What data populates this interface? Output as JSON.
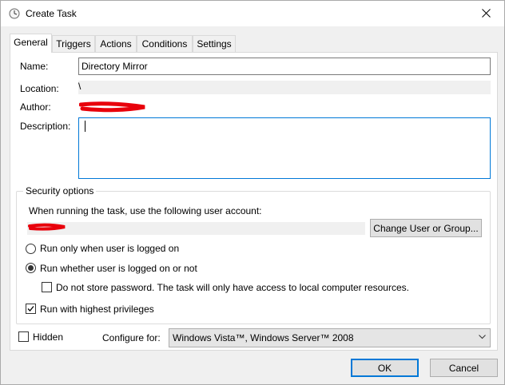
{
  "window": {
    "title": "Create Task",
    "close_icon": "close-icon",
    "app_icon": "clock-icon"
  },
  "tabs": [
    {
      "label": "General",
      "active": true
    },
    {
      "label": "Triggers",
      "active": false
    },
    {
      "label": "Actions",
      "active": false
    },
    {
      "label": "Conditions",
      "active": false
    },
    {
      "label": "Settings",
      "active": false
    }
  ],
  "general": {
    "name_label": "Name:",
    "name_value": "Directory Mirror",
    "location_label": "Location:",
    "location_value": "\\",
    "author_label": "Author:",
    "description_label": "Description:",
    "description_value": ""
  },
  "security": {
    "group_title": "Security options",
    "account_prompt": "When running the task, use the following user account:",
    "change_user_button": "Change User or Group...",
    "radio_logged_on": "Run only when user is logged on",
    "radio_whether": "Run whether user is logged on or not",
    "radio_selected": "whether",
    "no_store_password": "Do not store password.  The task will only have access to local computer resources.",
    "no_store_password_checked": false,
    "highest_privileges": "Run with highest privileges",
    "highest_privileges_checked": true
  },
  "footer": {
    "hidden_label": "Hidden",
    "hidden_checked": false,
    "configure_label": "Configure for:",
    "configure_value": "Windows Vista™, Windows Server™ 2008",
    "ok_button": "OK",
    "cancel_button": "Cancel"
  },
  "colors": {
    "accent": "#0078d7",
    "redaction": "#e8000b"
  }
}
